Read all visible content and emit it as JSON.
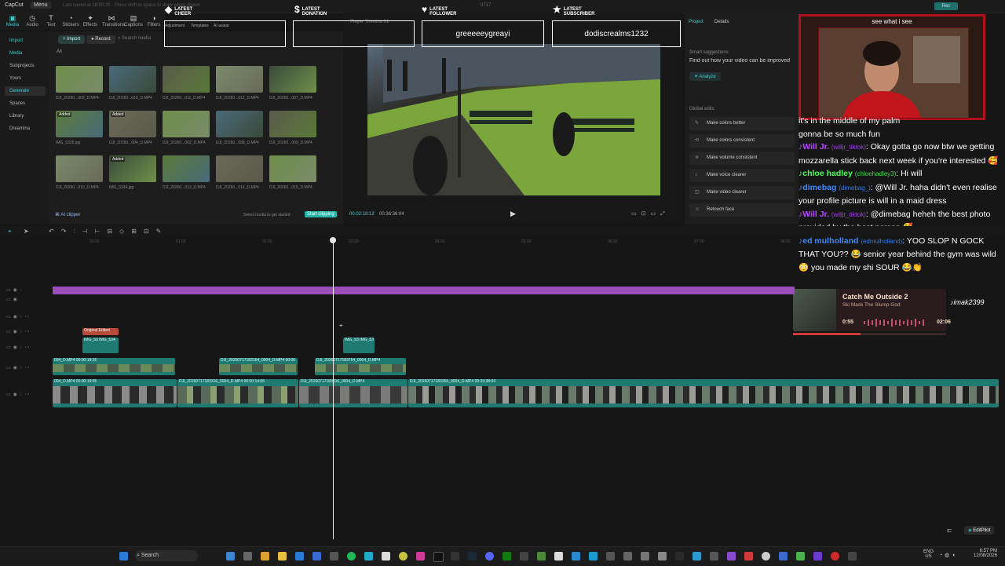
{
  "app": {
    "name": "CapCut",
    "menu": "Menu",
    "notice": "Last saved at 18:50:35 · Press shift to space to draw when shown",
    "top_center": "0717",
    "record_label": "Rec"
  },
  "toolbar": [
    {
      "label": "Media",
      "icon": "media-icon"
    },
    {
      "label": "Audio",
      "icon": "audio-icon"
    },
    {
      "label": "Text",
      "icon": "text-icon"
    },
    {
      "label": "Stickers",
      "icon": "stickers-icon"
    },
    {
      "label": "Effects",
      "icon": "effects-icon"
    },
    {
      "label": "Transitions",
      "icon": "transitions-icon"
    },
    {
      "label": "Captions",
      "icon": "captions-icon"
    },
    {
      "label": "Filters",
      "icon": "filters-icon"
    },
    {
      "label": "Adjustment",
      "icon": "adjustment-icon"
    },
    {
      "label": "Templates",
      "icon": "templates-icon"
    },
    {
      "label": "AI avatar",
      "icon": "ai-avatar-icon"
    }
  ],
  "leftnav": [
    "Import",
    "Media",
    "Subprojects",
    "Yours",
    "Generate",
    "Spaces",
    "Library",
    "Dreamina"
  ],
  "media": {
    "import": "Import",
    "record": "Record",
    "search_placeholder": "Search media",
    "filter_all": "All",
    "ai_clipper": "AI clipper",
    "select_hint": "Select media to get started",
    "start_clipping": "Start clipping",
    "items": [
      {
        "name": "DJI_20260...009_D.MP4",
        "badge": ""
      },
      {
        "name": "DJI_20260...010_D.MP4",
        "badge": ""
      },
      {
        "name": "DJI_20260...011_D.MP4",
        "badge": ""
      },
      {
        "name": "DJI_20260...012_D.MP4",
        "badge": ""
      },
      {
        "name": "DJI_20260...007_D.MP4",
        "badge": ""
      },
      {
        "name": "IMG_5335.jpg",
        "badge": "Added"
      },
      {
        "name": "DJI_20260...004_D.MP4",
        "badge": "Added"
      },
      {
        "name": "DJI_20260...002_D.MP4",
        "badge": ""
      },
      {
        "name": "DJI_20260...008_D.MP4",
        "badge": ""
      },
      {
        "name": "DJI_20260...009_D.MP4",
        "badge": ""
      },
      {
        "name": "DJI_20260...010_D.MP4",
        "badge": ""
      },
      {
        "name": "IMG_5334.jpg",
        "badge": "Added"
      },
      {
        "name": "DJI_20260...013_D.MP4",
        "badge": ""
      },
      {
        "name": "DJI_20260...014_D.MP4",
        "badge": ""
      },
      {
        "name": "DJI_20260...015_D.MP4",
        "badge": ""
      }
    ]
  },
  "player": {
    "title": "Player Timeline 01",
    "current": "00:02:18:12",
    "total": "00:36:36:04"
  },
  "rpanel": {
    "tab_project": "Project",
    "tab_details": "Details",
    "smart_title": "Smart suggestions",
    "smart_text": "Find out how your video can be improved",
    "analyze": "Analyze",
    "global_title": "Global edits",
    "edits": [
      "Make colors better",
      "Make colors consistent",
      "Make volume consistent",
      "Make voice clearer",
      "Make video clearer",
      "Retouch face"
    ]
  },
  "overlays": [
    {
      "head1": "LATEST",
      "head2": "CHEER",
      "value": "",
      "symbol": "◆"
    },
    {
      "head1": "LATEST",
      "head2": "DONATION",
      "value": "",
      "symbol": "$"
    },
    {
      "head1": "LATEST",
      "head2": "FOLLOWER",
      "value": "greeeeeygreayi",
      "symbol": "♥"
    },
    {
      "head1": "LATEST",
      "head2": "SUBSCRIBER",
      "value": "dodiscrealms1232",
      "symbol": "★"
    }
  ],
  "webcam": {
    "label": "see what i see"
  },
  "chat": [
    {
      "user": "",
      "handle": "",
      "text": "it's in the middle of my palm",
      "color": "#ff3a7a"
    },
    {
      "user": "",
      "handle": "",
      "text": "gonna be so much fun",
      "color": "#ffffff"
    },
    {
      "user": "Will Jr.",
      "handle": "(willjr_tiktok)",
      "text": ": Okay gotta go now btw we getting mozzarella stick back next week if you're interested 🥰",
      "color": "#b44aff"
    },
    {
      "user": "chloe hadley",
      "handle": "(chloehadley3)",
      "text": ": Hi will",
      "color": "#4aff5a"
    },
    {
      "user": "dimebag",
      "handle": "(dimebag_)",
      "text": ": @Will Jr. haha didn't even realise your profile picture is will in a maid dress",
      "color": "#3a8aff"
    },
    {
      "user": "Will Jr.",
      "handle": "(willjr_tiktok)",
      "text": ": @dimebag heheh the best photo provided by the best person 🥰",
      "color": "#b44aff"
    },
    {
      "user": "ed mulholland",
      "handle": "(edmulholland)",
      "text": ": YOO SLOP N GOCK THAT YOU?? 😂 senior year behind the gym was wild 😳 you made my shi SOUR 😂👏",
      "color": "#3a8aff"
    }
  ],
  "music": {
    "title": "Catch Me Outside 2",
    "artist": "Ski Mask The Slump God",
    "elapsed": "0:55",
    "duration": "02:06",
    "progress": 0.44,
    "tiktok_handle": "imak2399"
  },
  "timeline": {
    "ticks": [
      "00:00",
      "01:00",
      "02:00",
      "03:00",
      "04:00",
      "05:00",
      "06:00",
      "07:00",
      "08:00"
    ],
    "clips": [
      {
        "name": "Original  Edited",
        "track": "overlay"
      },
      {
        "name": "IMG_53  IMG_534",
        "track": "img"
      },
      {
        "name": "IMG_53  IMG_53",
        "track": "img"
      },
      {
        "name": "004_D.MP4  00:00:19:26",
        "track": "v2"
      },
      {
        "name": "DJI_20260717182154_0004_D.MP4  00:00",
        "track": "v2"
      },
      {
        "name": "DJI_20260717183754_0004_D.MP4",
        "track": "v2"
      },
      {
        "name": "004_D.MP4  00:00:19:05",
        "track": "main"
      },
      {
        "name": "DJI_20260717183316_0004_D.MP4  00:00:14:06",
        "track": "main"
      },
      {
        "name": "DJI_20260717183316_0004_D.MP4",
        "track": "main"
      },
      {
        "name": "DJI_20260717183355_0004_D.MP4  00:33:38:04",
        "track": "main"
      }
    ]
  },
  "editpilot": "EditPilot",
  "taskbar": {
    "search": "Search",
    "lang": "ENG",
    "region": "US",
    "time": "6:57 PM",
    "date": "12/08/2026"
  },
  "colors": {
    "accent": "#3ccfcf",
    "purple_track": "#9b4dbb",
    "teal_clip": "#1f7a72",
    "webcam_border": "#b0101c"
  }
}
